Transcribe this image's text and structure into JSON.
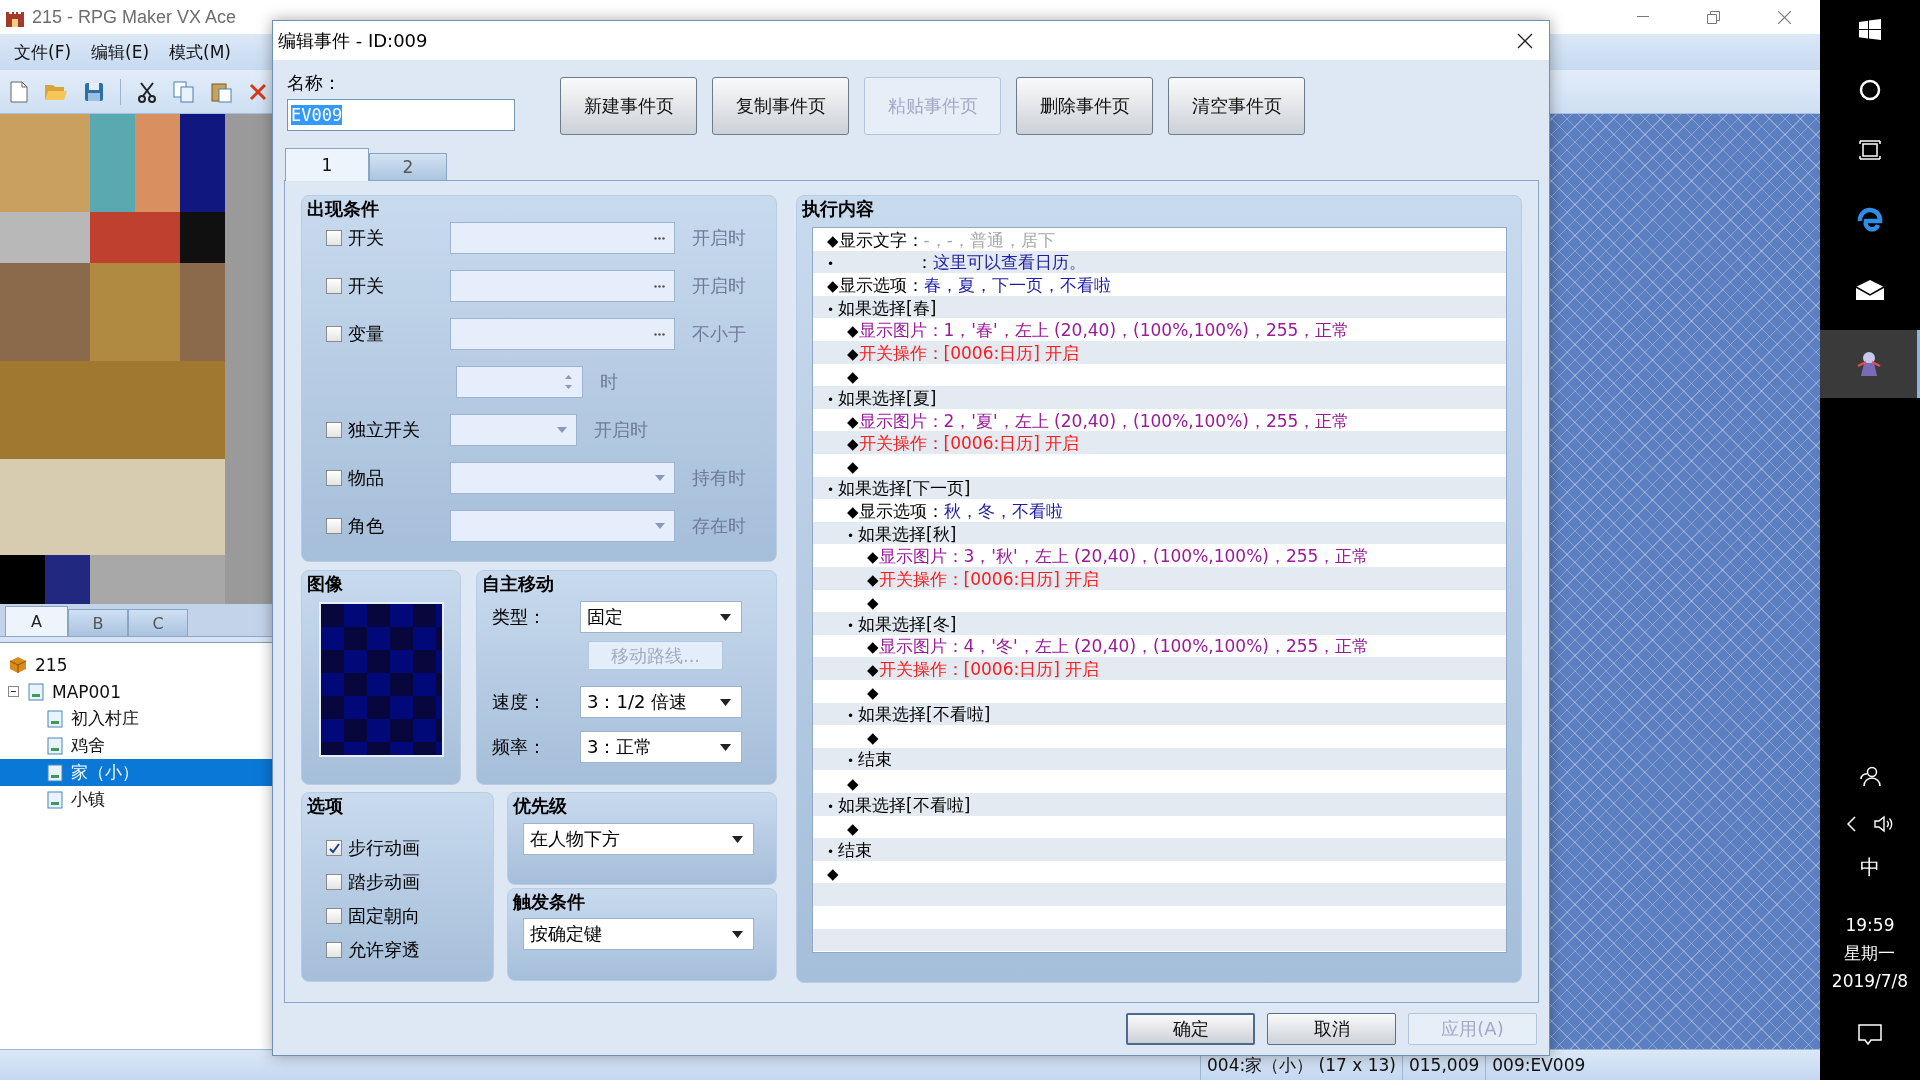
{
  "app": {
    "title": "215 - RPG Maker VX Ace",
    "menu": [
      "文件(F)",
      "编辑(E)",
      "模式(M)"
    ],
    "palette_tabs": [
      {
        "label": "A",
        "selected": true
      },
      {
        "label": "B",
        "selected": false
      },
      {
        "label": "C",
        "selected": false
      }
    ],
    "map_tree": [
      {
        "label": "215",
        "kind": "project",
        "selected": false
      },
      {
        "label": "MAP001",
        "kind": "map",
        "selected": false,
        "expanded": true,
        "children": [
          {
            "label": "初入村庄",
            "kind": "map",
            "selected": false
          },
          {
            "label": "鸡舍",
            "kind": "map",
            "selected": false
          },
          {
            "label": "家（小）",
            "kind": "map",
            "selected": true
          },
          {
            "label": "小镇",
            "kind": "map",
            "selected": false
          }
        ]
      }
    ],
    "status_bar": [
      "004:家（小） (17 x 13)",
      "015,009",
      "009:EV009"
    ]
  },
  "dialog": {
    "title": "编辑事件 - ID:009",
    "name_label": "名称：",
    "name_value": "EV009",
    "name_selected": true,
    "page_buttons": [
      {
        "label": "新建事件页",
        "disabled": false
      },
      {
        "label": "复制事件页",
        "disabled": false
      },
      {
        "label": "粘贴事件页",
        "disabled": true
      },
      {
        "label": "删除事件页",
        "disabled": false
      },
      {
        "label": "清空事件页",
        "disabled": false
      }
    ],
    "page_tabs": [
      {
        "label": "1",
        "selected": true
      },
      {
        "label": "2",
        "selected": false
      }
    ],
    "conditions": {
      "title": "出现条件",
      "rows": [
        {
          "label": "开关",
          "checked": false,
          "kind": "picker",
          "suffix": "开启时"
        },
        {
          "label": "开关",
          "checked": false,
          "kind": "picker",
          "suffix": "开启时"
        },
        {
          "label": "变量",
          "checked": false,
          "kind": "picker",
          "suffix": "不小于"
        },
        {
          "kind": "spinner",
          "suffix": "时"
        },
        {
          "label": "独立开关",
          "checked": false,
          "kind": "short_dropdown",
          "suffix": "开启时"
        },
        {
          "label": "物品",
          "checked": false,
          "kind": "dropdown",
          "suffix": "持有时"
        },
        {
          "label": "角色",
          "checked": false,
          "kind": "dropdown",
          "suffix": "存在时"
        }
      ]
    },
    "graphic": {
      "title": "图像"
    },
    "movement": {
      "title": "自主移动",
      "type_label": "类型：",
      "type_value": "固定",
      "route_button": {
        "label": "移动路线...",
        "disabled": true
      },
      "speed_label": "速度：",
      "speed_value": "3：1/2 倍速",
      "freq_label": "频率：",
      "freq_value": "3：正常"
    },
    "options": {
      "title": "选项",
      "items": [
        {
          "label": "步行动画",
          "checked": true
        },
        {
          "label": "踏步动画",
          "checked": false
        },
        {
          "label": "固定朝向",
          "checked": false
        },
        {
          "label": "允许穿透",
          "checked": false
        }
      ]
    },
    "priority": {
      "title": "优先级",
      "value": "在人物下方"
    },
    "trigger": {
      "title": "触发条件",
      "value": "按确定键"
    },
    "commands": {
      "title": "执行内容",
      "items": [
        {
          "marker": "◆",
          "label": "显示文字：",
          "detail": "-，-，普通，居下",
          "kind": "message"
        },
        {
          "marker": "•",
          "label": "：",
          "detail": "这里可以查看日历。",
          "kind": "message_line"
        },
        {
          "marker": "◆",
          "label": "显示选项：",
          "detail": "春，夏，下一页，不看啦",
          "kind": "choices"
        },
        {
          "marker": "•",
          "label": "如果选择[春]",
          "kind": "branch",
          "children": [
            {
              "marker": "◆",
              "label": "显示图片：1，'春'，左上 (20,40)，(100%,100%)，255，正常",
              "kind": "picture"
            },
            {
              "marker": "◆",
              "label": "开关操作：[0006:日历] 开启",
              "kind": "switch"
            },
            {
              "marker": "◆",
              "kind": "empty"
            }
          ]
        },
        {
          "marker": "•",
          "label": "如果选择[夏]",
          "kind": "branch",
          "children": [
            {
              "marker": "◆",
              "label": "显示图片：2，'夏'，左上 (20,40)，(100%,100%)，255，正常",
              "kind": "picture"
            },
            {
              "marker": "◆",
              "label": "开关操作：[0006:日历] 开启",
              "kind": "switch"
            },
            {
              "marker": "◆",
              "kind": "empty"
            }
          ]
        },
        {
          "marker": "•",
          "label": "如果选择[下一页]",
          "kind": "branch",
          "children": [
            {
              "marker": "◆",
              "label": "显示选项：",
              "detail": "秋，冬，不看啦",
              "kind": "choices"
            },
            {
              "marker": "•",
              "label": "如果选择[秋]",
              "kind": "branch",
              "children": [
                {
                  "marker": "◆",
                  "label": "显示图片：3，'秋'，左上 (20,40)，(100%,100%)，255，正常",
                  "kind": "picture"
                },
                {
                  "marker": "◆",
                  "label": "开关操作：[0006:日历] 开启",
                  "kind": "switch"
                },
                {
                  "marker": "◆",
                  "kind": "empty"
                }
              ]
            },
            {
              "marker": "•",
              "label": "如果选择[冬]",
              "kind": "branch",
              "children": [
                {
                  "marker": "◆",
                  "label": "显示图片：4，'冬'，左上 (20,40)，(100%,100%)，255，正常",
                  "kind": "picture"
                },
                {
                  "marker": "◆",
                  "label": "开关操作：[0006:日历] 开启",
                  "kind": "switch"
                },
                {
                  "marker": "◆",
                  "kind": "empty"
                }
              ]
            },
            {
              "marker": "•",
              "label": "如果选择[不看啦]",
              "kind": "branch",
              "children": [
                {
                  "marker": "◆",
                  "kind": "empty"
                }
              ]
            },
            {
              "marker": "•",
              "label": "结束",
              "kind": "end"
            },
            {
              "marker": "◆",
              "kind": "empty"
            }
          ]
        },
        {
          "marker": "•",
          "label": "如果选择[不看啦]",
          "kind": "branch",
          "children": [
            {
              "marker": "◆",
              "kind": "empty"
            }
          ]
        },
        {
          "marker": "•",
          "label": "结束",
          "kind": "end"
        },
        {
          "marker": "◆",
          "kind": "empty"
        }
      ]
    },
    "footer_buttons": [
      {
        "label": "确定",
        "disabled": false
      },
      {
        "label": "取消",
        "disabled": false
      },
      {
        "label": "应用(A)",
        "disabled": true
      }
    ]
  },
  "taskbar": {
    "ime": "中",
    "time": "19:59",
    "weekday": "星期一",
    "date": "2019/7/8"
  }
}
